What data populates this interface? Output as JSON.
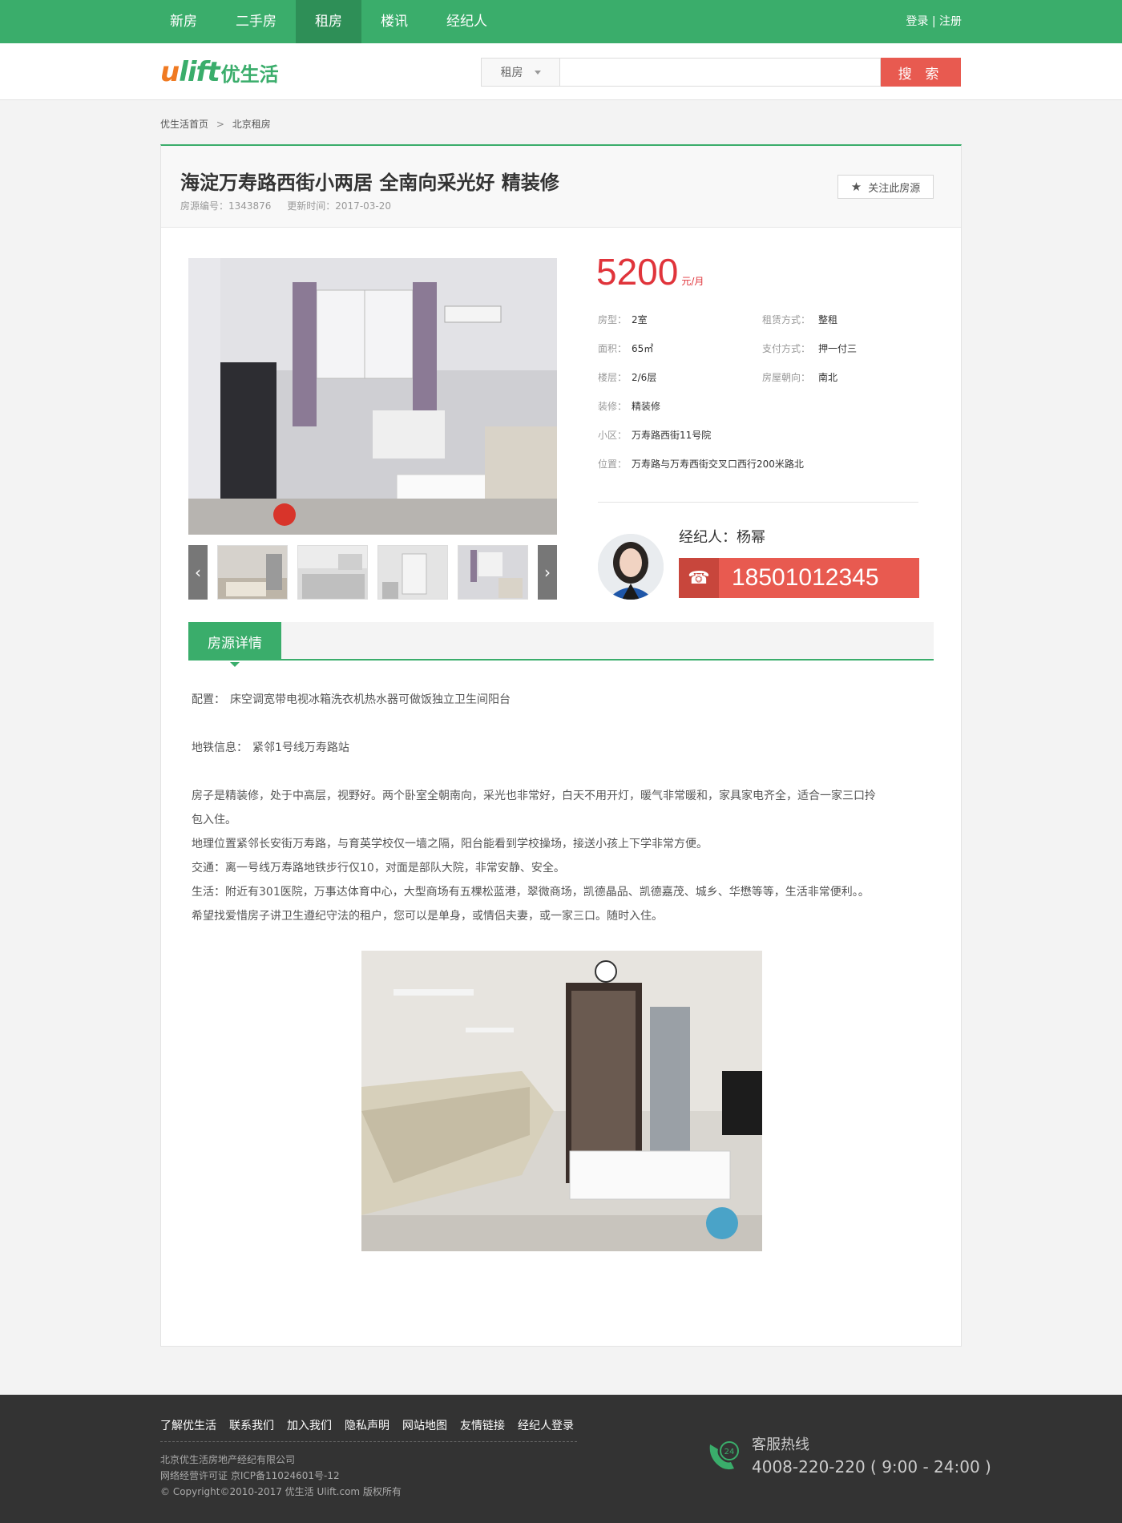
{
  "topnav": {
    "items": [
      {
        "label": "新房"
      },
      {
        "label": "二手房"
      },
      {
        "label": "租房"
      },
      {
        "label": "楼讯"
      },
      {
        "label": "经纪人"
      }
    ],
    "active": "租房",
    "login": "登录",
    "auth_sep": "|",
    "register": "注册"
  },
  "header": {
    "logo_en_main": "u",
    "logo_en_accent": "lift",
    "logo_cn": "优生活",
    "search_type": "租房",
    "search_placeholder": "",
    "search_button": "搜 索"
  },
  "breadcrumb": {
    "home": "优生活首页",
    "sep": ">",
    "current": "北京租房"
  },
  "listing": {
    "title": "海淀万寿路西街小两居 全南向采光好 精装修",
    "id_label": "房源编号：1343876",
    "updated_label": "更新时间：2017-03-20",
    "follow_label": "关注此房源",
    "price": "5200",
    "price_unit": "元/月",
    "attrs": {
      "layout_k": "房型：",
      "layout_v": "2室",
      "rent_mode_k": "租赁方式：",
      "rent_mode_v": "整租",
      "area_k": "面积：",
      "area_v": "65㎡",
      "pay_k": "支付方式：",
      "pay_v": "押一付三",
      "floor_k": "楼层：",
      "floor_v": "2/6层",
      "orient_k": "房屋朝向：",
      "orient_v": "南北",
      "deco_k": "装修：",
      "deco_v": "精装修",
      "community_k": "小区：",
      "community_v": "万寿路西街11号院",
      "location_k": "位置：",
      "location_v": "万寿路与万寿西街交叉口西行200米路北"
    },
    "agent_label": "经纪人：杨幂",
    "agent_phone": "18501012345"
  },
  "detail": {
    "tab": "房源详情",
    "config_k": "配置：",
    "config_v": "床空调宽带电视冰箱洗衣机热水器可做饭独立卫生间阳台",
    "subway_k": "地铁信息：",
    "subway_v": "紧邻1号线万寿路站",
    "desc": [
      "房子是精装修，处于中高层，视野好。两个卧室全朝南向，采光也非常好，白天不用开灯，暖气非常暖和，家具家电齐全，适合一家三口拎",
      "包入住。",
      "地理位置紧邻长安街万寿路，与育英学校仅一墙之隔，阳台能看到学校操场，接送小孩上下学非常方便。",
      "交通：离一号线万寿路地铁步行仅10，对面是部队大院，非常安静、安全。",
      "生活：附近有301医院，万事达体育中心，大型商场有五棵松蓝港，翠微商场，凯德晶品、凯德嘉茂、城乡、华懋等等，生活非常便利。。",
      "希望找爱惜房子讲卫生遵纪守法的租户，您可以是单身，或情侣夫妻，或一家三口。随时入住。"
    ]
  },
  "footer": {
    "links": [
      "了解优生活",
      "联系我们",
      "加入我们",
      "隐私声明",
      "网站地图",
      "友情链接",
      "经纪人登录"
    ],
    "company": "北京优生活房地产经纪有限公司",
    "license": "网络经营许可证 京ICP备11024601号-12",
    "copyright": "© Copyright©2010-2017 优生活 Ulift.com 版权所有",
    "hotline_title": "客服热线",
    "hotline_num": "4008-220-220 ( 9:00 - 24:00 )",
    "hotline_badge": "24"
  },
  "colors": {
    "brand_green": "#3aad6b",
    "accent_red": "#e85a50",
    "price_red": "#e0343b",
    "logo_orange": "#f07a22"
  },
  "icons": {
    "follow": "star-icon",
    "phone": "telephone-icon",
    "hotline": "phone-24h-icon",
    "prev": "chevron-left-icon",
    "next": "chevron-right-icon"
  }
}
